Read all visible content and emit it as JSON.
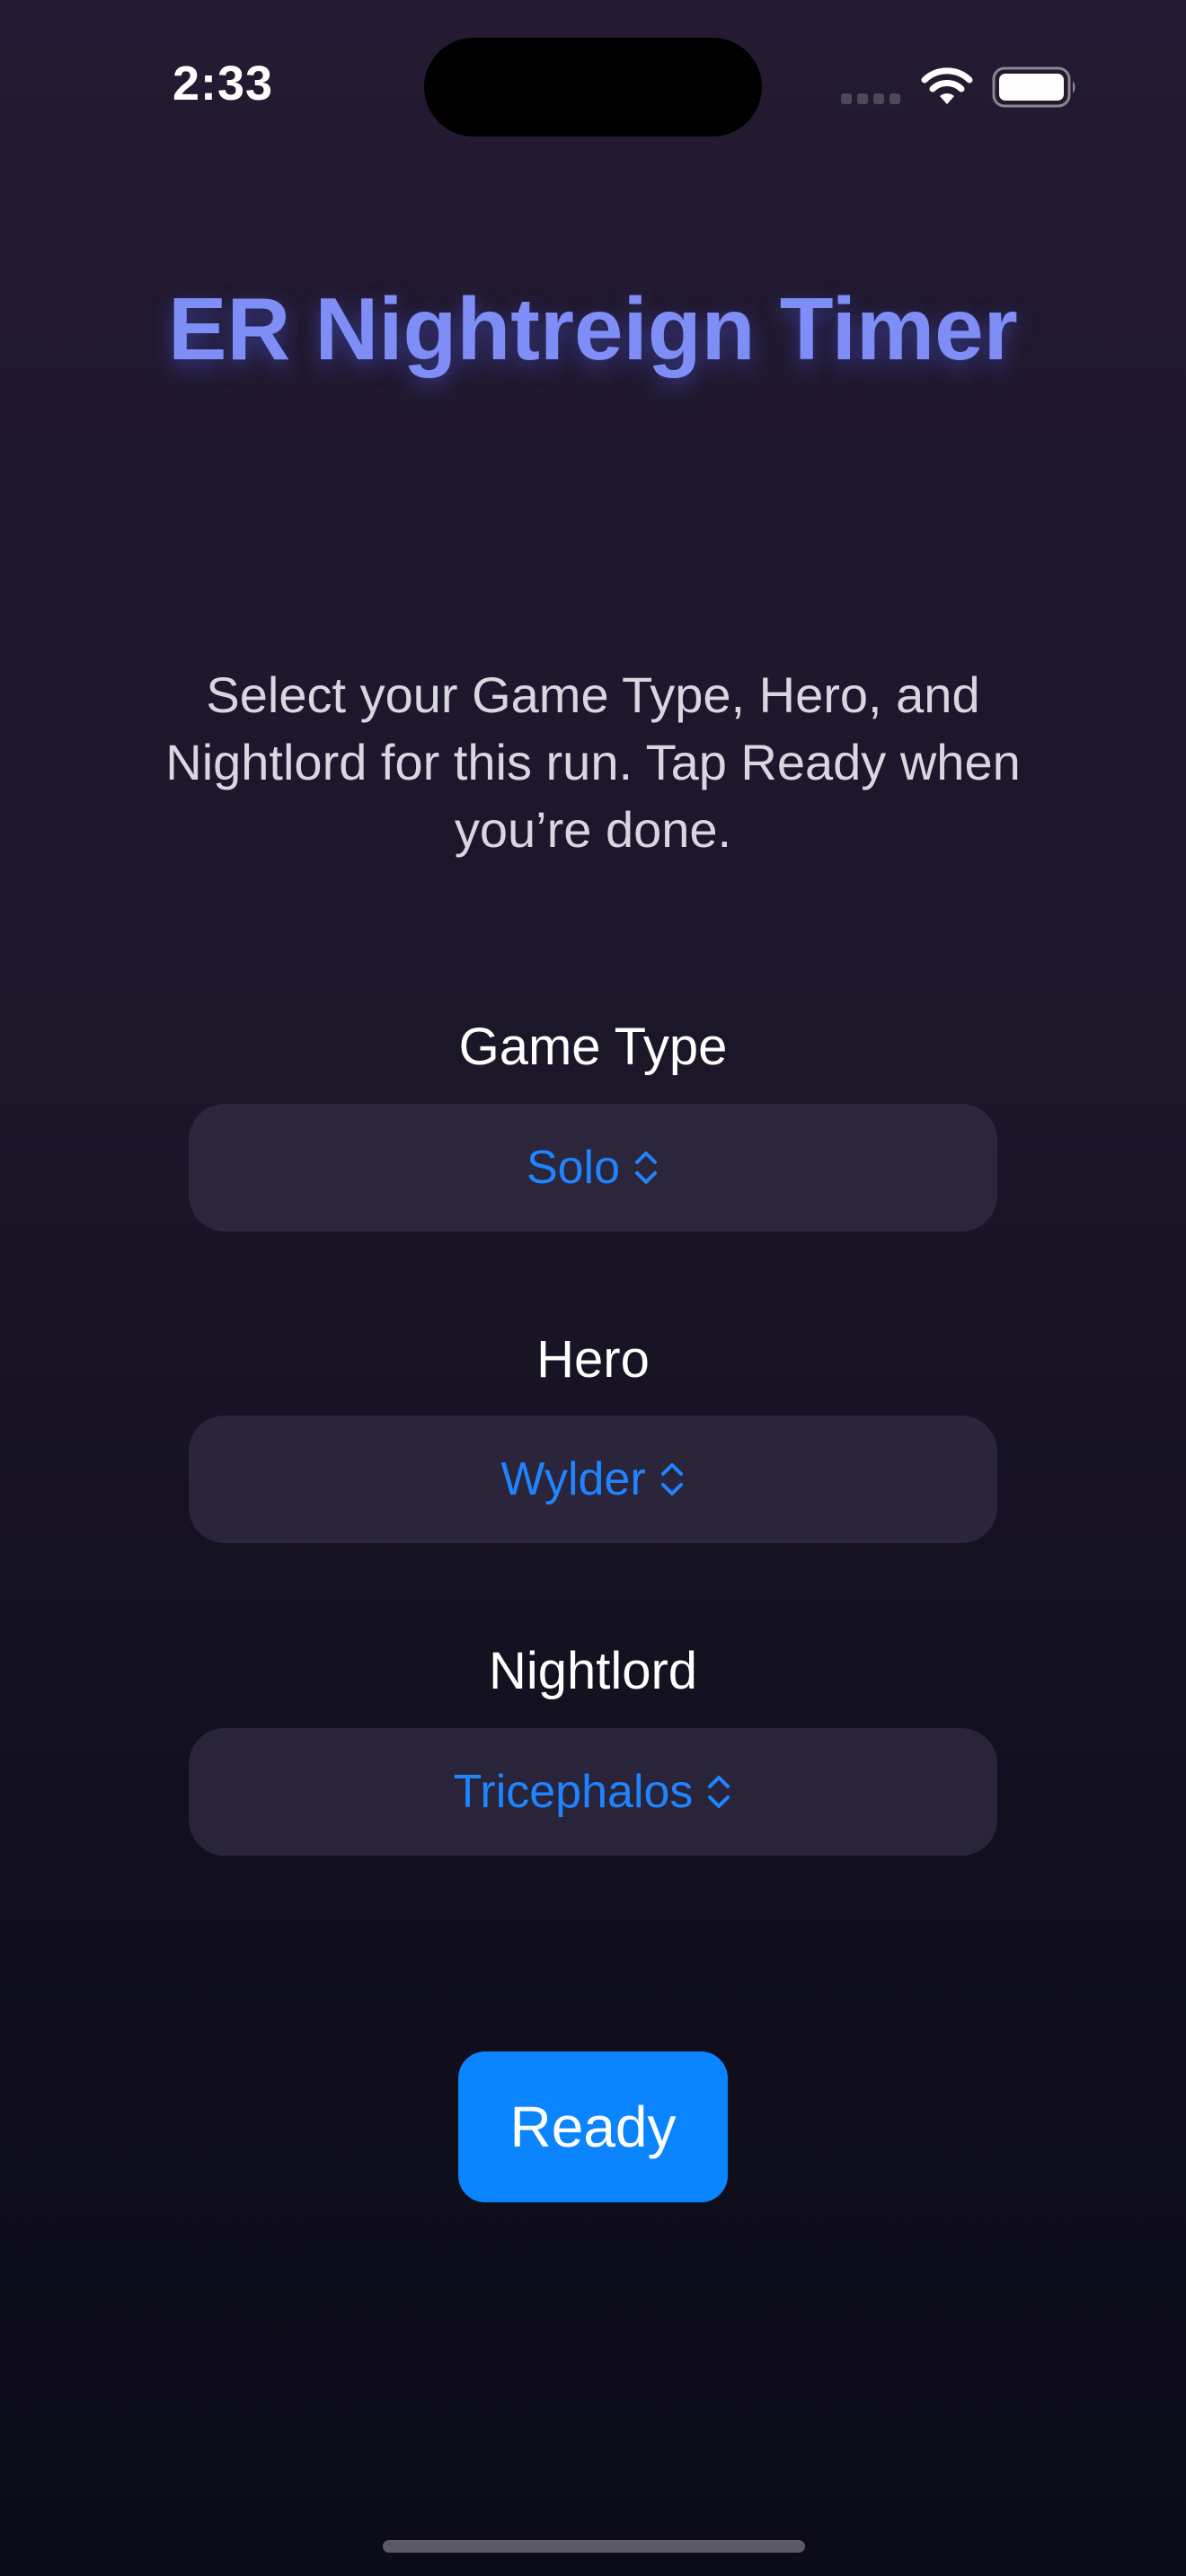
{
  "status_bar": {
    "time": "2:33"
  },
  "title": "ER Nightreign Timer",
  "instructions": "Select your Game Type, Hero, and Nightlord for this run. Tap Ready when you’re done.",
  "sections": {
    "game_type": {
      "label": "Game Type",
      "value": "Solo"
    },
    "hero": {
      "label": "Hero",
      "value": "Wylder"
    },
    "nightlord": {
      "label": "Nightlord",
      "value": "Tricephalos"
    }
  },
  "ready_button": {
    "label": "Ready"
  },
  "colors": {
    "accent": "#0a84ff",
    "title": "#7f8df6",
    "picker_text": "#1f84ff"
  },
  "icons": [
    "cellular-signal-icon",
    "wifi-icon",
    "battery-icon",
    "chevron-up-down-icon"
  ]
}
